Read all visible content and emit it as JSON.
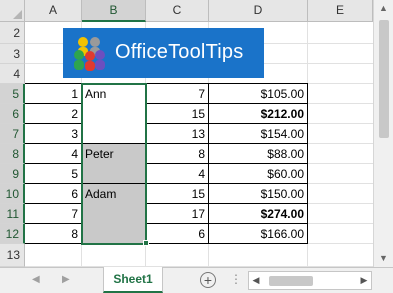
{
  "columns": [
    "A",
    "B",
    "C",
    "D",
    "E"
  ],
  "rows": [
    "2",
    "3",
    "4",
    "5",
    "6",
    "7",
    "8",
    "9",
    "10",
    "11",
    "12",
    "13"
  ],
  "logo": {
    "text": "OfficeToolTips"
  },
  "table": [
    {
      "a": "1",
      "b": "Ann",
      "c": "7",
      "d": "$105.00",
      "bold": false
    },
    {
      "a": "2",
      "b": "",
      "c": "15",
      "d": "$212.00",
      "bold": true
    },
    {
      "a": "3",
      "b": "",
      "c": "13",
      "d": "$154.00",
      "bold": false
    },
    {
      "a": "4",
      "b": "Peter",
      "c": "8",
      "d": "$88.00",
      "bold": false
    },
    {
      "a": "5",
      "b": "",
      "c": "4",
      "d": "$60.00",
      "bold": false
    },
    {
      "a": "6",
      "b": "Adam",
      "c": "15",
      "d": "$150.00",
      "bold": false
    },
    {
      "a": "7",
      "b": "",
      "c": "17",
      "d": "$274.00",
      "bold": true
    },
    {
      "a": "8",
      "b": "",
      "c": "6",
      "d": "$166.00",
      "bold": false
    }
  ],
  "sheet_tab": "Sheet1",
  "add_sheet": "+",
  "icons": {
    "prev_sheet": "◀",
    "next_sheet": "▶",
    "scroll_up": "▲",
    "scroll_down": "▼",
    "scroll_left": "◀",
    "scroll_right": "▶",
    "more": "⋮"
  },
  "colors": {
    "accent": "#217346",
    "logo_bg": "#1a73c9",
    "gray_fill": "#c9c9c9"
  }
}
